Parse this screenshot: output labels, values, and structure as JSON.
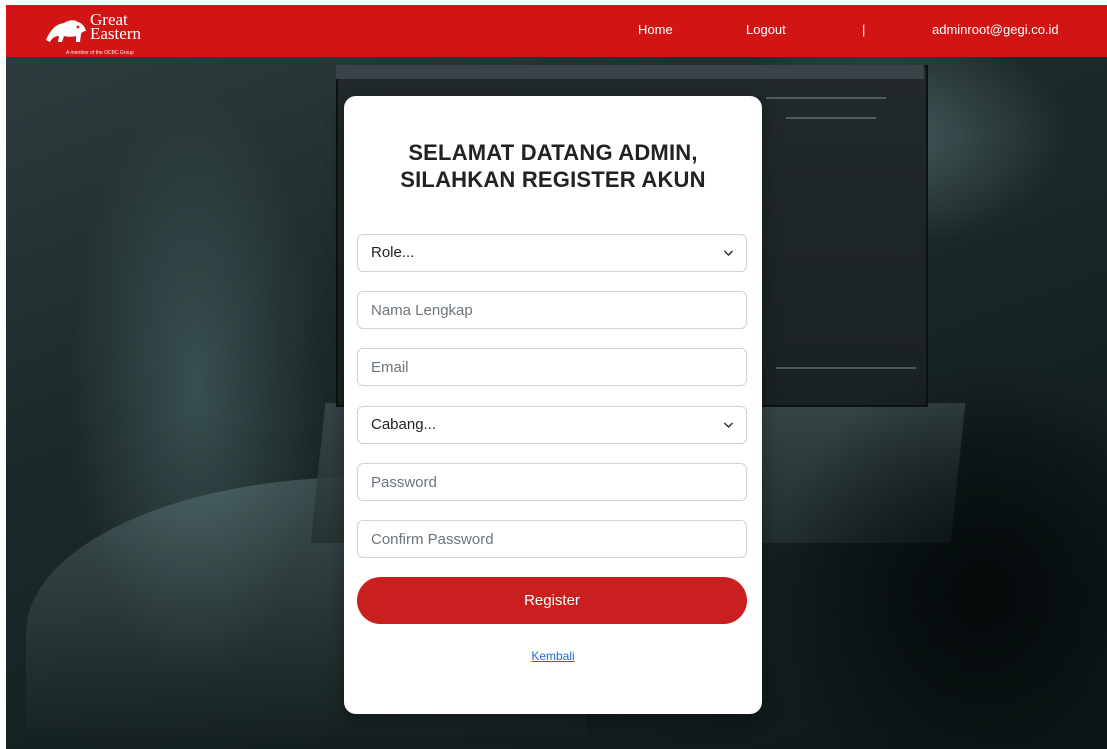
{
  "brand": {
    "logo_line1": "Great",
    "logo_line2": "Eastern",
    "logo_tagline": "A member of the OCBC Group",
    "color": "#d11414"
  },
  "nav": {
    "home": "Home",
    "logout": "Logout",
    "separator": "|",
    "user_email": "adminroot@gegi.co.id"
  },
  "form": {
    "title_line1": "SELAMAT DATANG ADMIN,",
    "title_line2": "SILAHKAN REGISTER AKUN",
    "role_select": "Role...",
    "nama_placeholder": "Nama Lengkap",
    "email_placeholder": "Email",
    "cabang_select": "Cabang...",
    "password_placeholder": "Password",
    "confirm_placeholder": "Confirm Password",
    "register_label": "Register",
    "back_label": "Kembali",
    "button_color": "#c91f1f"
  }
}
